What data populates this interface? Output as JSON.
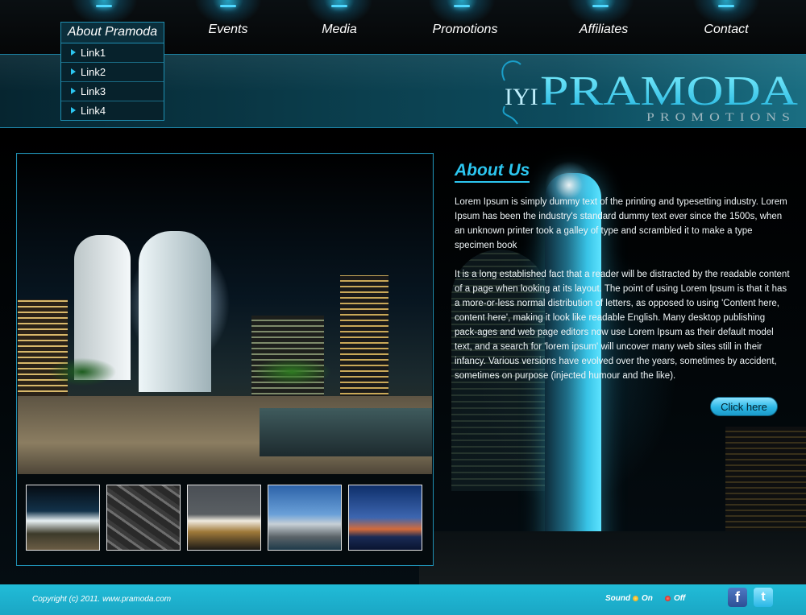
{
  "nav": {
    "items": [
      {
        "label": "About Pramoda"
      },
      {
        "label": "Events"
      },
      {
        "label": "Media"
      },
      {
        "label": "Promotions"
      },
      {
        "label": "Affiliates"
      },
      {
        "label": "Contact"
      }
    ],
    "dropdown": {
      "links": [
        "Link1",
        "Link2",
        "Link3",
        "Link4"
      ]
    }
  },
  "logo": {
    "name": "PRAMODA",
    "sub": "PROMOTIONS",
    "mark": "IYI"
  },
  "about": {
    "title": "About Us",
    "paragraph1": "Lorem Ipsum is simply dummy text of the printing and typesetting industry. Lorem Ipsum has been the industry's standard dummy text ever since the 1500s, when an unknown printer took a galley of type and scrambled it to make a type specimen book",
    "paragraph2": "It is a long established fact that a reader will be distracted by the readable content of a page when looking at its layout. The point of using Lorem Ipsum is that it has a more-or-less normal distribution of letters, as opposed to using 'Content here, content here', making it look like readable English. Many desktop publishing pack-ages and web page editors now use Lorem Ipsum as their default model text, and a search for 'lorem ipsum' will uncover many web sites still in their infancy. Various versions have evolved over the years, sometimes by accident, sometimes on purpose (injected humour and the like).",
    "button_label": "Click here"
  },
  "footer": {
    "copyright": "Copyright (c) 2011. www.pramoda.com",
    "sound_label": "Sound",
    "sound_on": "On",
    "sound_off": "Off"
  },
  "colors": {
    "accent": "#2cc6f0",
    "banner": "#0b3f4e",
    "footer": "#1fb4d2"
  },
  "icons": {
    "facebook": "facebook-icon",
    "twitter": "twitter-icon"
  }
}
